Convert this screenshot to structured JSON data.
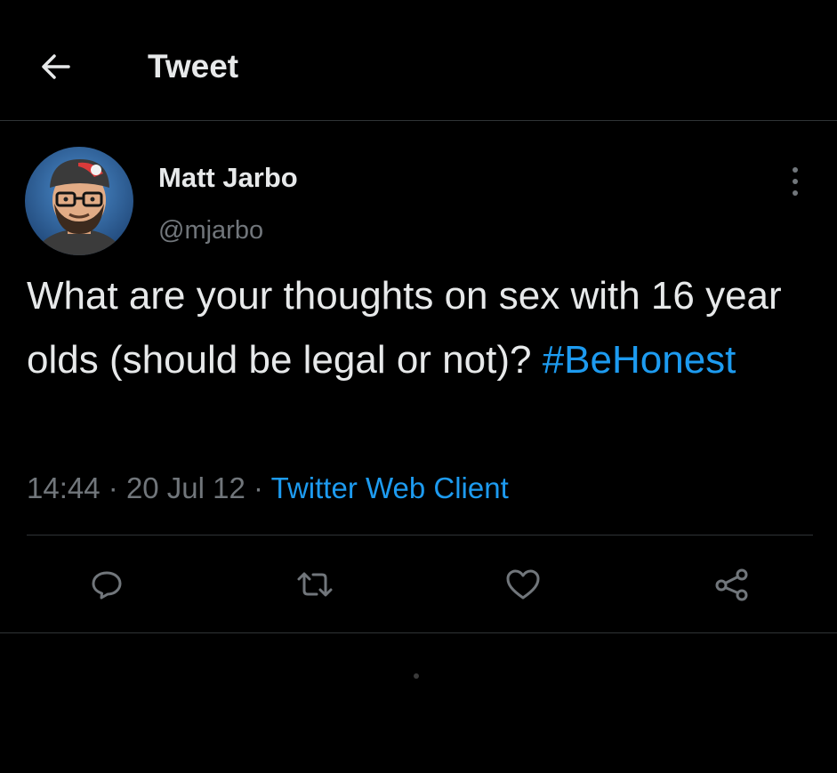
{
  "header": {
    "title": "Tweet"
  },
  "author": {
    "display_name": "Matt Jarbo",
    "handle": "@mjarbo"
  },
  "tweet": {
    "text": "What are your thoughts on sex with 16 year olds (should be legal or not)? ",
    "hashtag": "#BeHonest",
    "time": "14:44",
    "separator": "·",
    "date": "20 Jul 12",
    "source": "Twitter Web Client"
  },
  "actions": [
    {
      "name": "reply",
      "icon": "reply-icon"
    },
    {
      "name": "retweet",
      "icon": "retweet-icon"
    },
    {
      "name": "like",
      "icon": "heart-icon"
    },
    {
      "name": "share",
      "icon": "share-icon"
    }
  ],
  "colors": {
    "background": "#000000",
    "text": "#e7e9ea",
    "muted": "#71767b",
    "accent": "#1d9bf0",
    "divider": "#2f3336"
  }
}
